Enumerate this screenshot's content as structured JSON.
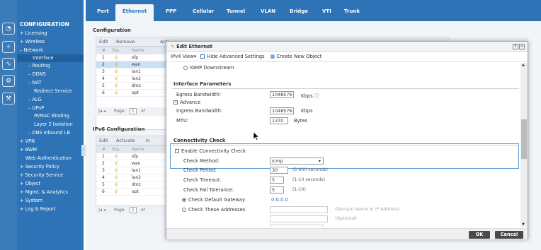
{
  "colors": {
    "accent": "#2d73b5",
    "sidebar": "#2d73b5",
    "selected_row": "#cbe0f4",
    "button": "#4a4a4a",
    "link": "#2e6fb5"
  },
  "icons": [
    "dashboard-icon",
    "wizard-icon",
    "monitor-icon",
    "gear-icon",
    "maintenance-icon"
  ],
  "topnav": {
    "tabs": [
      "Port",
      "Ethernet",
      "PPP",
      "Cellular",
      "Tunnel",
      "VLAN",
      "Bridge",
      "VTI",
      "Trunk"
    ],
    "active": "Ethernet"
  },
  "sidebar": {
    "header": "CONFIGURATION",
    "items": [
      {
        "label": "+ Licensing"
      },
      {
        "label": "+ Wireless"
      },
      {
        "label": "– Network"
      },
      {
        "label": "Interface"
      },
      {
        "label": "– Routing"
      },
      {
        "label": "– DDNS"
      },
      {
        "label": "– NAT"
      },
      {
        "label": "Redirect Service"
      },
      {
        "label": "– ALG"
      },
      {
        "label": "– UPnP"
      },
      {
        "label": "IP/MAC Binding"
      },
      {
        "label": "Layer 2 Isolation"
      },
      {
        "label": "– DNS Inbound LB"
      },
      {
        "label": "+ VPN"
      },
      {
        "label": "+ BWM"
      },
      {
        "label": "Web Authentication"
      },
      {
        "label": "+ Security Policy"
      },
      {
        "label": "+ Security Service"
      },
      {
        "label": "+ Object"
      },
      {
        "label": "+ Mgmt. & Analytics"
      },
      {
        "label": "+ System"
      },
      {
        "label": "+ Log & Report"
      }
    ]
  },
  "config": {
    "title": "Configuration",
    "toolbar": [
      "Edit",
      "Remove",
      "Acti",
      "Inactiv",
      "Create Virtual Interface",
      "References"
    ],
    "headers": [
      "#",
      "Sta...",
      "Name"
    ],
    "rows": [
      {
        "n": "1",
        "name": "sfp"
      },
      {
        "n": "2",
        "name": "wan"
      },
      {
        "n": "3",
        "name": "lan1"
      },
      {
        "n": "4",
        "name": "lan2"
      },
      {
        "n": "5",
        "name": "dmz"
      },
      {
        "n": "6",
        "name": "opt"
      }
    ],
    "pager": {
      "page_label": "Page",
      "page": "1",
      "of": "of"
    }
  },
  "ipv6": {
    "title": "IPv6 Configuration",
    "toolbar": [
      "Edit",
      "Activate",
      "In"
    ],
    "headers": [
      "#",
      "Sta...",
      "Name"
    ],
    "rows": [
      {
        "n": "1",
        "name": "sfp"
      },
      {
        "n": "2",
        "name": "wan"
      },
      {
        "n": "3",
        "name": "lan1"
      },
      {
        "n": "4",
        "name": "lan2"
      },
      {
        "n": "5",
        "name": "dmz"
      },
      {
        "n": "6",
        "name": "opt"
      }
    ],
    "pager": {
      "page_label": "Page",
      "page": "1",
      "of": "of"
    }
  },
  "dialog": {
    "title": "Edit Ethernet",
    "toolbar": {
      "view": "IPv4 View▾",
      "hide_adv": "Hide Advanced Settings",
      "create": "Create New Object"
    },
    "igmp": "IGMP Downstream",
    "interface_parameters": "Interface Parameters",
    "egress_label": "Egress Bandwidth:",
    "egress_value": "1048576",
    "kbps": "Kbps",
    "advance": "Advance",
    "ingress_label": "Ingress Bandwidth:",
    "ingress_value": "1048576",
    "ingress_unit": "Kbps",
    "mtu_label": "MTU:",
    "mtu_value": "1370",
    "mtu_unit": "Bytes",
    "connectivity": "Connectivity Check",
    "enable_cc": "Enable Connectivity Check",
    "method_label": "Check Method:",
    "method_value": "icmp",
    "period_label": "Check Period:",
    "period_value": "30",
    "period_hint": "(5-600 seconds)",
    "timeout_label": "Check Timeout:",
    "timeout_value": "5",
    "timeout_hint": "(1-10 seconds)",
    "fail_label": "Check Fail Tolerance:",
    "fail_value": "5",
    "fail_hint": "(1-10)",
    "default_gw": "Check Default Gateway",
    "gw_value": "0.0.0.0",
    "these_addr": "Check These Addresses",
    "addr_hint": "(Domain Name or IP Address)",
    "optional": "(Optional)",
    "ok": "OK",
    "cancel": "Cancel"
  }
}
